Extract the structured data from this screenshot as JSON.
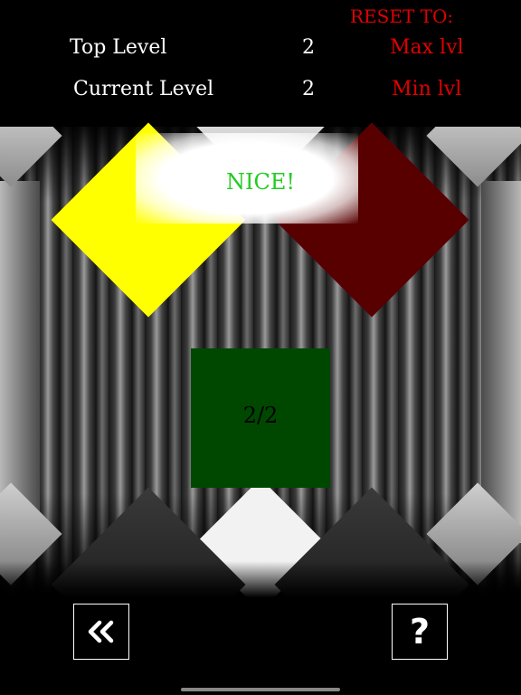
{
  "stats": {
    "top_level_label": "Top Level",
    "top_level_value": "2",
    "current_level_label": "Current Level",
    "current_level_value": "2"
  },
  "reset": {
    "title": "RESET TO:",
    "max_label": "Max lvl",
    "min_label": "Min lvl"
  },
  "game": {
    "feedback": "NICE!",
    "progress": "2/2",
    "colors": {
      "yellow": "#ffff00",
      "dark_red": "#580000",
      "dark_green": "#004800",
      "bottom_diamonds": "#262626"
    }
  },
  "controls": {
    "back_icon": "double-chevron-left-icon",
    "help_icon": "question-mark-icon"
  }
}
